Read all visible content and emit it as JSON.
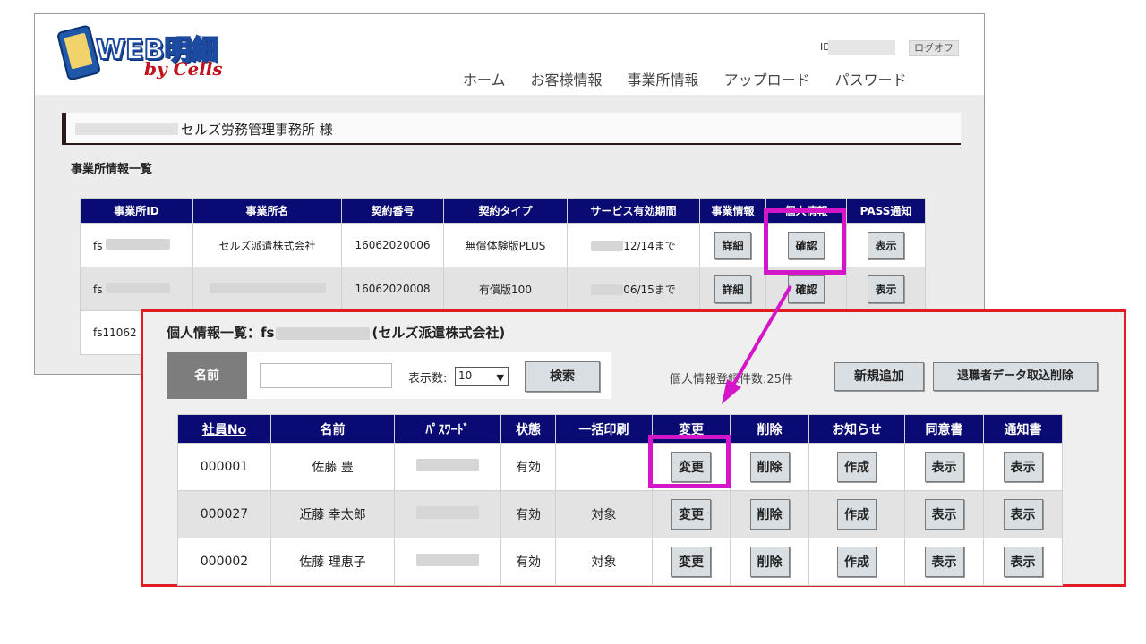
{
  "back": {
    "logo": {
      "main": "WEB明細",
      "sub": "by Cells"
    },
    "id_label": "ID",
    "logoff": "ログオフ",
    "nav": [
      "ホーム",
      "お客様情報",
      "事業所情報",
      "アップロード",
      "パスワード"
    ],
    "company_name": "セルズ労務管理事務所 様",
    "section_title": "事業所情報一覧",
    "columns": [
      "事業所ID",
      "事業所名",
      "契約番号",
      "契約タイプ",
      "サービス有効期間",
      "事業情報",
      "個人情報",
      "PASS通知"
    ],
    "rows": [
      {
        "id": "fs",
        "name": "セルズ派遣株式会社",
        "contract": "16062020006",
        "type": "無償体験版PLUS",
        "period": "12/14まで",
        "detail": "詳細",
        "confirm": "確認",
        "pass": "表示"
      },
      {
        "id": "fs",
        "name": "",
        "contract": "16062020008",
        "type": "有償版100",
        "period": "06/15まで",
        "detail": "詳細",
        "confirm": "確認",
        "pass": "表示"
      },
      {
        "id": "fs11062"
      }
    ]
  },
  "front": {
    "title_prefix": "個人情報一覧：fs",
    "title_suffix": "(セルズ派遣株式会社)",
    "name_label": "名前",
    "name_value": "",
    "disp_label": "表示数:",
    "disp_value": "10",
    "search_btn": "検索",
    "count_text": "個人情報登録件数:25件",
    "add_btn": "新規追加",
    "import_btn": "退職者データ取込削除",
    "columns": [
      "社員No",
      "名前",
      "ﾊﾟｽﾜｰﾄﾞ",
      "状態",
      "一括印刷",
      "変更",
      "削除",
      "お知らせ",
      "同意書",
      "通知書"
    ],
    "rows": [
      {
        "no": "000001",
        "name": "佐藤 豊",
        "status": "有効",
        "print": "",
        "change": "変更",
        "del": "削除",
        "notice": "作成",
        "consent": "表示",
        "notify": "表示"
      },
      {
        "no": "000027",
        "name": "近藤 幸太郎",
        "status": "有効",
        "print": "対象",
        "change": "変更",
        "del": "削除",
        "notice": "作成",
        "consent": "表示",
        "notify": "表示"
      },
      {
        "no": "000002",
        "name": "佐藤 理恵子",
        "status": "有効",
        "print": "対象",
        "change": "変更",
        "del": "削除",
        "notice": "作成",
        "consent": "表示",
        "notify": "表示"
      }
    ]
  },
  "colors": {
    "header_navy": "#0a0a74",
    "highlight": "#d415c8",
    "frame_red": "#e01b24"
  }
}
